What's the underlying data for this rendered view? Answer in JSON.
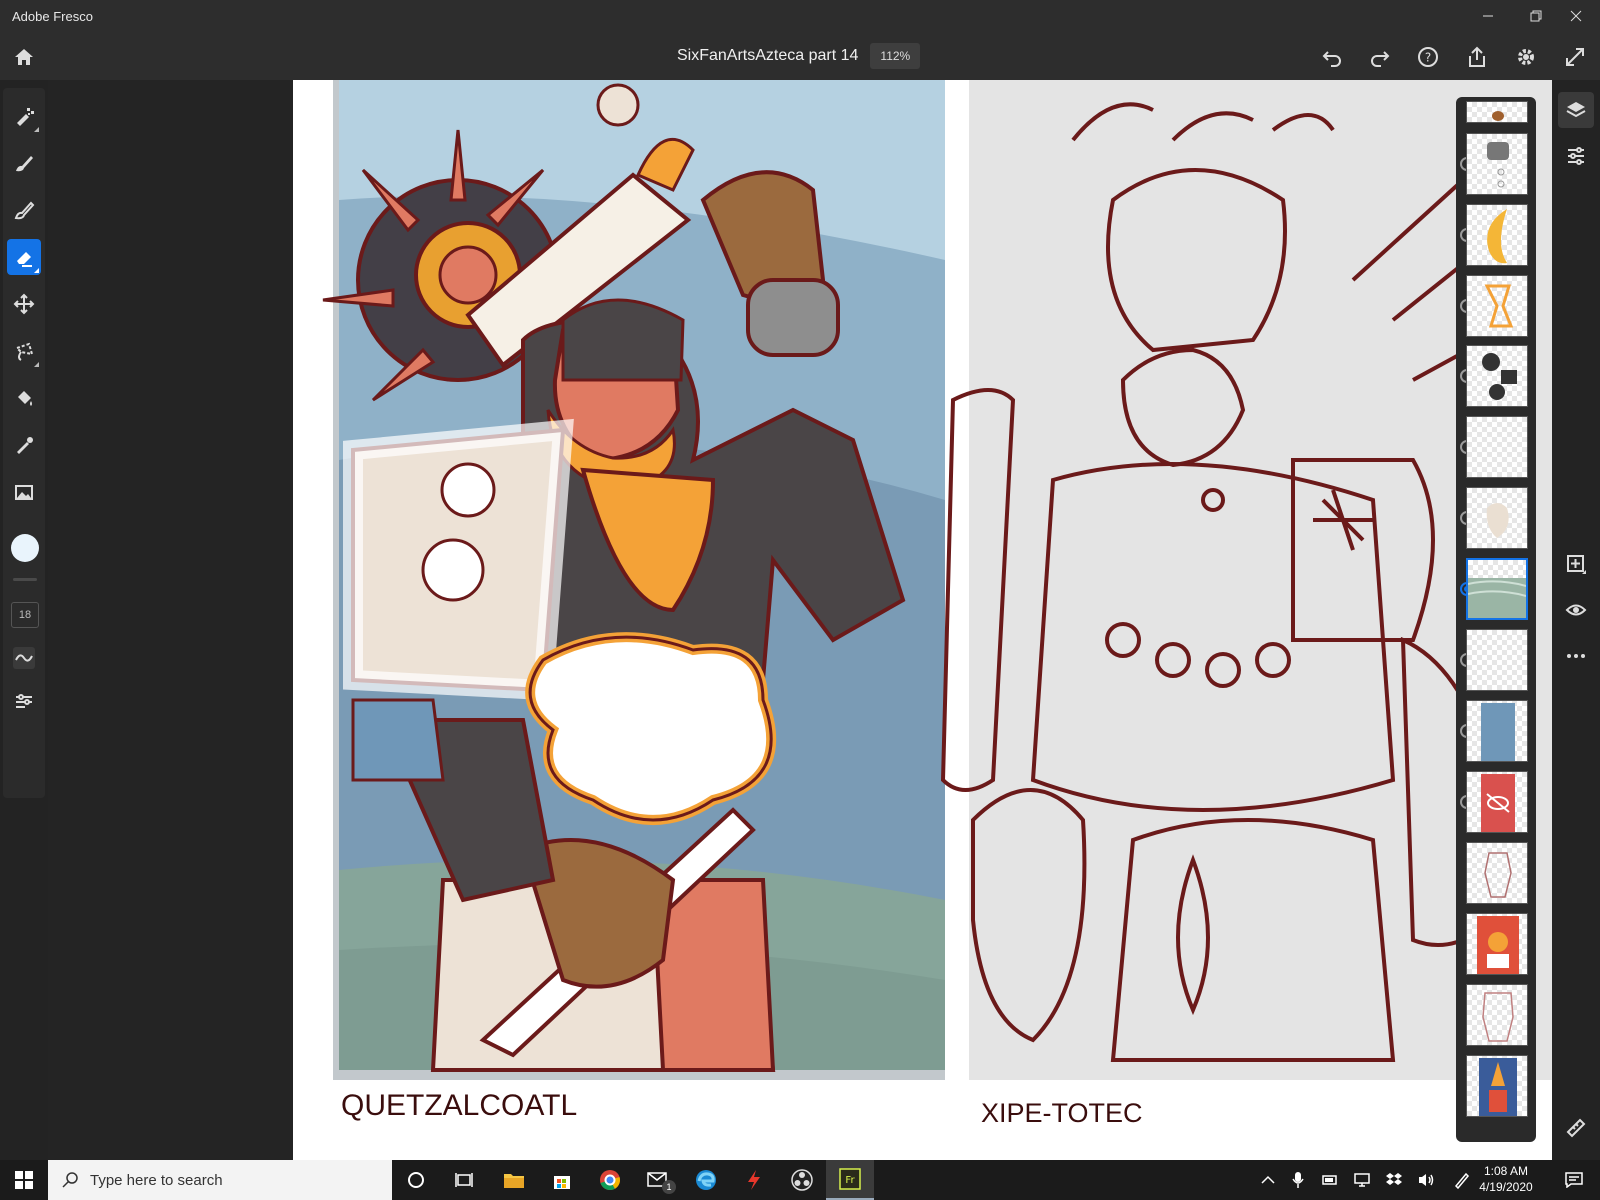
{
  "window": {
    "title": "Adobe Fresco"
  },
  "document": {
    "name": "SixFanArtsAzteca part 14",
    "zoom": "112%"
  },
  "tools": [
    "pixel-brush",
    "live-brush",
    "vector-brush",
    "eraser",
    "move",
    "lasso",
    "fill",
    "eyedropper",
    "place-image"
  ],
  "active_tool": "eraser",
  "brush_size": "18",
  "color": {
    "current": "#e9f4fc",
    "accent": "#1473e6"
  },
  "artwork": {
    "left_caption": "QUETZALCOATL",
    "right_caption": "XIPE-TOTEC"
  },
  "layers": {
    "count_visible": 14,
    "selected_index": 6,
    "hidden_index": 9
  },
  "taskbar": {
    "search_placeholder": "Type here to search",
    "time": "1:08 AM",
    "date": "4/19/2020",
    "mail_badge": "1"
  }
}
